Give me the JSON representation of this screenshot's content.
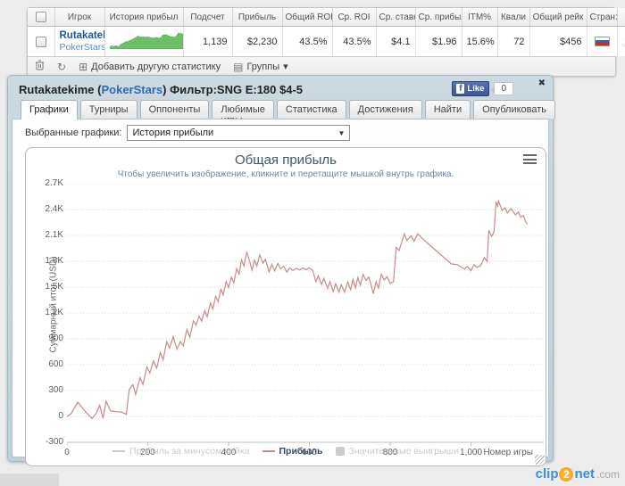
{
  "results_table": {
    "columns": [
      "Игрок",
      "История прибыл",
      "Подсчет",
      "Прибыль",
      "Общий ROI",
      "Ср. ROI",
      "Ср. ставк:",
      "Ср. прибыл",
      "ITM%",
      "Квали",
      "Общий рейк",
      "Стран:",
      ""
    ],
    "row": {
      "player": "Rutakatekime",
      "site": "PokerStars",
      "count": "1,139",
      "profit": "$2,230",
      "total_roi": "43.5%",
      "avg_roi": "43.5%",
      "avg_stake": "$4.1",
      "avg_profit": "$1.96",
      "itm": "15.6%",
      "quali": "72",
      "total_rake": "$456",
      "country": "Russia",
      "remove_label": "x"
    },
    "toolbar": {
      "trash_icon": "trash",
      "refresh_icon": "↻",
      "add_stat_icon": "⊞",
      "add_stat_label": "Добавить другую статистику",
      "groups_icon": "▤",
      "groups_label": "Группы",
      "groups_arrow": "▾"
    }
  },
  "panel": {
    "title_prefix": "Rutakatekime (",
    "title_site": "PokerStars",
    "title_suffix": ") Фильтр:SNG E:180 $4-5",
    "like_f": "f",
    "like_label": "Like",
    "like_count": "0",
    "close_icon": "✖",
    "tabs": [
      "Графики",
      "Турниры",
      "Оппоненты",
      "Любимые игры",
      "Статистика",
      "Достижения",
      "Найти",
      "Опубликовать"
    ],
    "active_tab": "Графики",
    "graph_select_label": "Выбранные графики:",
    "graph_select_value": "История прибыли",
    "graph_select_arrow": "▼"
  },
  "chart_data": {
    "type": "line",
    "title": "Общая прибыль",
    "subtitle": "Чтобы увеличить изображение, кликните и перетащите мышкой внутрь графика.",
    "xlabel": "Номер игры",
    "ylabel": "Суммарный итог (USD)",
    "xlim": [
      0,
      1180
    ],
    "ylim": [
      -300,
      2700
    ],
    "grid": "horizontal-dotted",
    "legend_position": "bottom",
    "x_ticks": [
      {
        "v": 0,
        "label": "0"
      },
      {
        "v": 200,
        "label": "200"
      },
      {
        "v": 400,
        "label": "400"
      },
      {
        "v": 600,
        "label": "600"
      },
      {
        "v": 800,
        "label": "800"
      },
      {
        "v": 1000,
        "label": "1,000"
      }
    ],
    "y_ticks": [
      {
        "v": -300,
        "label": "-300"
      },
      {
        "v": 0,
        "label": "0"
      },
      {
        "v": 300,
        "label": "300"
      },
      {
        "v": 600,
        "label": "600"
      },
      {
        "v": 900,
        "label": "900"
      },
      {
        "v": 1200,
        "label": "1.2K"
      },
      {
        "v": 1500,
        "label": "1.5K"
      },
      {
        "v": 1800,
        "label": "1.8K"
      },
      {
        "v": 2100,
        "label": "2.1K"
      },
      {
        "v": 2400,
        "label": "2.4K"
      },
      {
        "v": 2700,
        "label": "2.7K"
      }
    ],
    "legend": [
      {
        "label": "Прибыль за минусом рейка",
        "type": "line",
        "color": "#cccccc",
        "enabled": false
      },
      {
        "label": "Прибыль",
        "type": "line",
        "color": "#c98a8a",
        "enabled": true
      },
      {
        "label": "Значительные выигрыши",
        "type": "box",
        "color": "#cccccc",
        "enabled": false
      }
    ],
    "series": [
      {
        "name": "Прибыль",
        "color": "#c98a8a",
        "points": [
          [
            0,
            0
          ],
          [
            10,
            30
          ],
          [
            27,
            165
          ],
          [
            45,
            60
          ],
          [
            62,
            -25
          ],
          [
            73,
            40
          ],
          [
            81,
            130
          ],
          [
            89,
            -20
          ],
          [
            97,
            175
          ],
          [
            108,
            65
          ],
          [
            120,
            55
          ],
          [
            135,
            50
          ],
          [
            147,
            25
          ],
          [
            154,
            310
          ],
          [
            163,
            370
          ],
          [
            170,
            255
          ],
          [
            181,
            450
          ],
          [
            188,
            370
          ],
          [
            198,
            575
          ],
          [
            205,
            505
          ],
          [
            214,
            645
          ],
          [
            222,
            560
          ],
          [
            231,
            740
          ],
          [
            238,
            660
          ],
          [
            247,
            870
          ],
          [
            254,
            790
          ],
          [
            263,
            925
          ],
          [
            272,
            780
          ],
          [
            281,
            870
          ],
          [
            288,
            820
          ],
          [
            297,
            1010
          ],
          [
            304,
            920
          ],
          [
            313,
            1110
          ],
          [
            319,
            1060
          ],
          [
            327,
            1165
          ],
          [
            333,
            1105
          ],
          [
            341,
            1225
          ],
          [
            347,
            1155
          ],
          [
            355,
            1315
          ],
          [
            361,
            1245
          ],
          [
            368,
            1395
          ],
          [
            374,
            1330
          ],
          [
            381,
            1475
          ],
          [
            387,
            1410
          ],
          [
            394,
            1565
          ],
          [
            400,
            1495
          ],
          [
            407,
            1615
          ],
          [
            413,
            1550
          ],
          [
            420,
            1715
          ],
          [
            426,
            1650
          ],
          [
            432,
            1815
          ],
          [
            438,
            1745
          ],
          [
            445,
            1910
          ],
          [
            452,
            1800
          ],
          [
            458,
            1697
          ],
          [
            464,
            1812
          ],
          [
            470,
            1747
          ],
          [
            477,
            1873
          ],
          [
            485,
            1777
          ],
          [
            491,
            1823
          ],
          [
            500,
            1675
          ],
          [
            507,
            1763
          ],
          [
            514,
            1687
          ],
          [
            522,
            1775
          ],
          [
            529,
            1713
          ],
          [
            536,
            1743
          ],
          [
            544,
            1675
          ],
          [
            551,
            1723
          ],
          [
            559,
            1692
          ],
          [
            568,
            1718
          ],
          [
            577,
            1700
          ],
          [
            584,
            1722
          ],
          [
            592,
            1702
          ],
          [
            599,
            1725
          ],
          [
            608,
            1695
          ],
          [
            616,
            1565
          ],
          [
            622,
            1632
          ],
          [
            630,
            1532
          ],
          [
            636,
            1600
          ],
          [
            645,
            1487
          ],
          [
            651,
            1562
          ],
          [
            659,
            1447
          ],
          [
            665,
            1540
          ],
          [
            673,
            1442
          ],
          [
            679,
            1528
          ],
          [
            687,
            1440
          ],
          [
            695,
            1562
          ],
          [
            702,
            1470
          ],
          [
            708,
            1590
          ],
          [
            714,
            1492
          ],
          [
            720,
            1612
          ],
          [
            726,
            1522
          ],
          [
            733,
            1648
          ],
          [
            740,
            1578
          ],
          [
            747,
            1618
          ],
          [
            752,
            1542
          ],
          [
            758,
            1425
          ],
          [
            765,
            1560
          ],
          [
            771,
            1490
          ],
          [
            778,
            1652
          ],
          [
            785,
            1582
          ],
          [
            792,
            1622
          ],
          [
            800,
            1542
          ],
          [
            808,
            1562
          ],
          [
            815,
            1960
          ],
          [
            822,
            1925
          ],
          [
            835,
            2120
          ],
          [
            841,
            2040
          ],
          [
            852,
            2095
          ],
          [
            859,
            2030
          ],
          [
            868,
            2120
          ],
          [
            885,
            2040
          ],
          [
            907,
            1950
          ],
          [
            929,
            1860
          ],
          [
            951,
            1770
          ],
          [
            967,
            1760
          ],
          [
            984,
            1710
          ],
          [
            991,
            1740
          ],
          [
            1000,
            1690
          ],
          [
            1007,
            1760
          ],
          [
            1015,
            1730
          ],
          [
            1024,
            1750
          ],
          [
            1033,
            1840
          ],
          [
            1040,
            1800
          ],
          [
            1044,
            2160
          ],
          [
            1051,
            2090
          ],
          [
            1057,
            2140
          ],
          [
            1062,
            2490
          ],
          [
            1066,
            2440
          ],
          [
            1068,
            2500
          ],
          [
            1077,
            2390
          ],
          [
            1084,
            2420
          ],
          [
            1090,
            2360
          ],
          [
            1099,
            2410
          ],
          [
            1110,
            2340
          ],
          [
            1117,
            2370
          ],
          [
            1123,
            2310
          ],
          [
            1130,
            2330
          ],
          [
            1134,
            2270
          ],
          [
            1139,
            2230
          ]
        ]
      }
    ]
  },
  "footer": {
    "logo_clip": "clip",
    "logo_two": "2",
    "logo_net": "net",
    "logo_com": ".com"
  }
}
